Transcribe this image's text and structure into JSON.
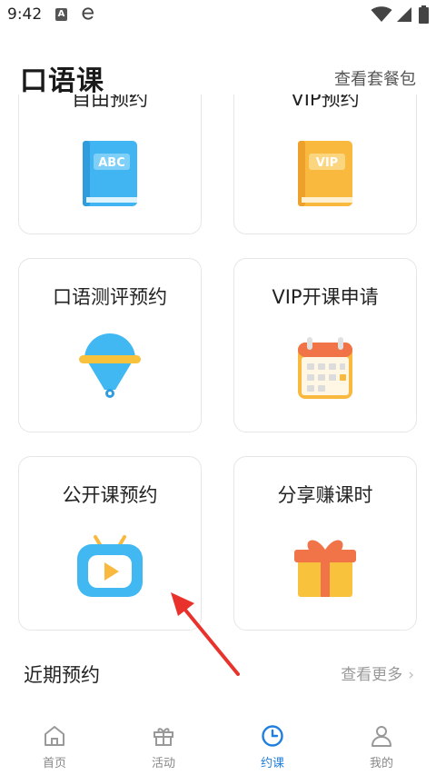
{
  "status_bar": {
    "time": "9:42",
    "notification_a": "A"
  },
  "header": {
    "title": "口语课",
    "link": "查看套餐包"
  },
  "cards": [
    {
      "label": "自由预约",
      "icon": "abc-book-icon"
    },
    {
      "label": "VIP预约",
      "icon": "vip-book-icon"
    },
    {
      "label": "口语测评预约",
      "icon": "evaluation-icon"
    },
    {
      "label": "VIP开课申请",
      "icon": "calendar-icon"
    },
    {
      "label": "公开课预约",
      "icon": "tv-play-icon"
    },
    {
      "label": "分享赚课时",
      "icon": "gift-icon"
    }
  ],
  "icon_text": {
    "abc": "ABC",
    "vip": "VIP"
  },
  "recent": {
    "title": "近期预约",
    "more": "查看更多"
  },
  "tabs": [
    {
      "label": "首页",
      "icon": "home-icon",
      "active": false
    },
    {
      "label": "活动",
      "icon": "gift-tab-icon",
      "active": false
    },
    {
      "label": "约课",
      "icon": "clock-icon",
      "active": true
    },
    {
      "label": "我的",
      "icon": "user-icon",
      "active": false
    }
  ],
  "colors": {
    "accent": "#1f7fe0",
    "book_blue": "#41b4f2",
    "book_orange": "#f9b93e",
    "annotation": "#e8322b"
  }
}
